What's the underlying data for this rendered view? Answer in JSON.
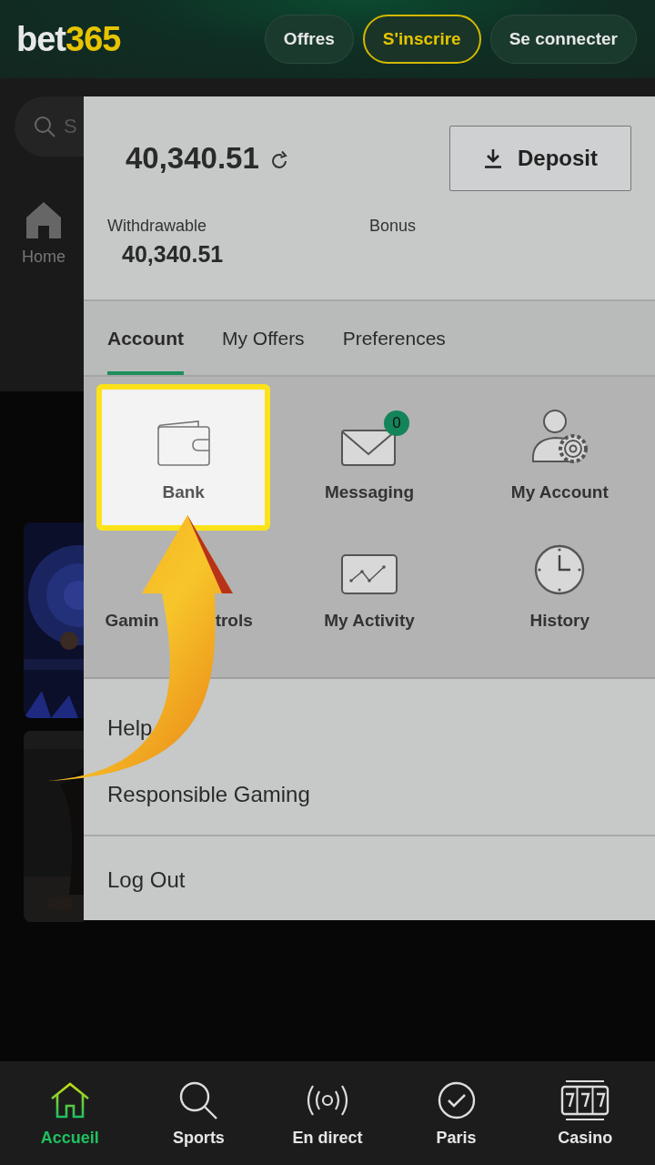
{
  "header": {
    "logo": {
      "word": "bet",
      "number": "365"
    },
    "buttons": [
      {
        "label": "Offres",
        "kind": "plain"
      },
      {
        "label": "S'inscrire",
        "kind": "outline"
      },
      {
        "label": "Se connecter",
        "kind": "plain"
      }
    ]
  },
  "background": {
    "search": {
      "placeholder": "S"
    },
    "home_label": "Home"
  },
  "account_panel": {
    "balance": "40,340.51",
    "deposit_button": "Deposit",
    "withdrawable": {
      "label": "Withdrawable",
      "value": "40,340.51"
    },
    "bonus": {
      "label": "Bonus"
    },
    "tabs": [
      {
        "label": "Account",
        "selected": true
      },
      {
        "label": "My Offers",
        "selected": false
      },
      {
        "label": "Preferences",
        "selected": false
      }
    ],
    "tiles": [
      {
        "label_parts": [
          "Bank"
        ],
        "highlighted": true
      },
      {
        "label_parts": [
          "Messaging"
        ],
        "highlighted": false,
        "badge": "0"
      },
      {
        "label_parts": [
          "My Account"
        ],
        "highlighted": false
      },
      {
        "label_parts": [
          "Gamin",
          "trols"
        ],
        "highlighted": false
      },
      {
        "label_parts": [
          "My Activity"
        ],
        "highlighted": false
      },
      {
        "label_parts": [
          "History"
        ],
        "highlighted": false
      }
    ],
    "link_groups": [
      {
        "items": [
          "Help",
          "Responsible Gaming"
        ]
      },
      {
        "items": [
          "Log Out"
        ]
      }
    ]
  },
  "bottom_nav": [
    {
      "label": "Accueil",
      "selected": true
    },
    {
      "label": "Sports",
      "selected": false
    },
    {
      "label": "En direct",
      "selected": false
    },
    {
      "label": "Paris",
      "selected": false
    },
    {
      "label": "Casino",
      "selected": false
    }
  ]
}
